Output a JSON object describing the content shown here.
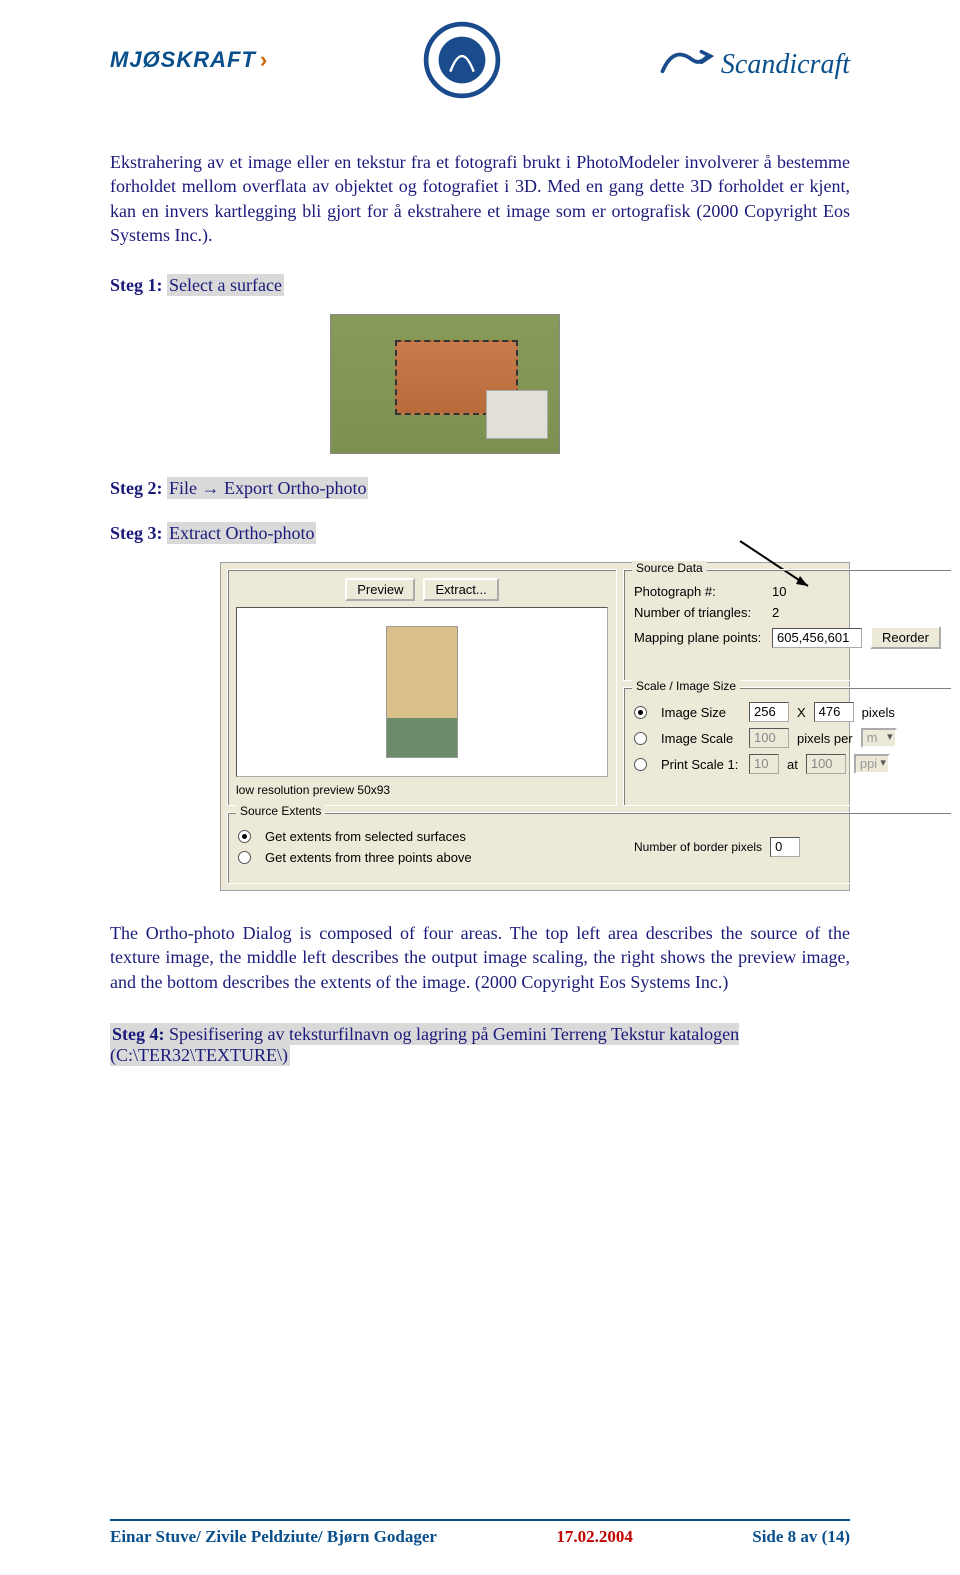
{
  "logos": {
    "left": "MJØSKRAFT",
    "right": "Scandicraft"
  },
  "para1": "Ekstrahering av et image eller en tekstur fra et fotografi brukt i PhotoModeler involverer å bestemme forholdet mellom overflata av objektet og fotografiet i 3D. Med en gang dette 3D forholdet er kjent, kan en invers kartlegging bli gjort for å ekstrahere et image som er ortografisk (2000 Copyright Eos Systems Inc.).",
  "steps": {
    "s1_label": "Steg 1:",
    "s1_text": "Select a surface",
    "s2_label": "Steg 2:",
    "s2_text": "File → Export Ortho-photo",
    "s3_label": "Steg 3:",
    "s3_text": "Extract Ortho-photo",
    "s4_label": "Steg 4:",
    "s4_text": "Spesifisering av teksturfilnavn og lagring på Gemini Terreng Tekstur katalogen (C:\\TER32\\TEXTURE\\)"
  },
  "dialog": {
    "source_data_legend": "Source Data",
    "photo_lbl": "Photograph #:",
    "photo_val": "10",
    "tri_lbl": "Number of triangles:",
    "tri_val": "2",
    "map_lbl": "Mapping plane points:",
    "map_val": "605,456,601",
    "reorder_btn": "Reorder",
    "scale_legend": "Scale / Image Size",
    "opt_imgsize": "Image Size",
    "imgsize_w": "256",
    "imgsize_x": "X",
    "imgsize_h": "476",
    "imgsize_unit": "pixels",
    "opt_imgscale": "Image Scale",
    "imgscale_val": "100",
    "imgscale_per": "pixels per",
    "imgscale_unit": "m",
    "opt_print": "Print Scale 1:",
    "print_v1": "10",
    "print_at": "at",
    "print_v2": "100",
    "print_unit": "ppi",
    "preview_btn": "Preview",
    "extract_btn": "Extract...",
    "preview_caption": "low resolution preview  50x93",
    "extents_legend": "Source Extents",
    "ext_opt1": "Get extents from selected surfaces",
    "ext_opt2": "Get extents from three points above",
    "border_lbl": "Number of border pixels",
    "border_val": "0"
  },
  "para2": "The Ortho-photo Dialog is composed of four areas. The top left area describes the source of the texture image, the middle left describes the output image scaling, the right shows the preview image, and the bottom describes the extents of the image. (2000 Copyright Eos Systems Inc.)",
  "footer": {
    "authors": "Einar Stuve/ Zivile Peldziute/ Bjørn Godager",
    "date": "17.02.2004",
    "page": "Side 8 av (14)"
  }
}
